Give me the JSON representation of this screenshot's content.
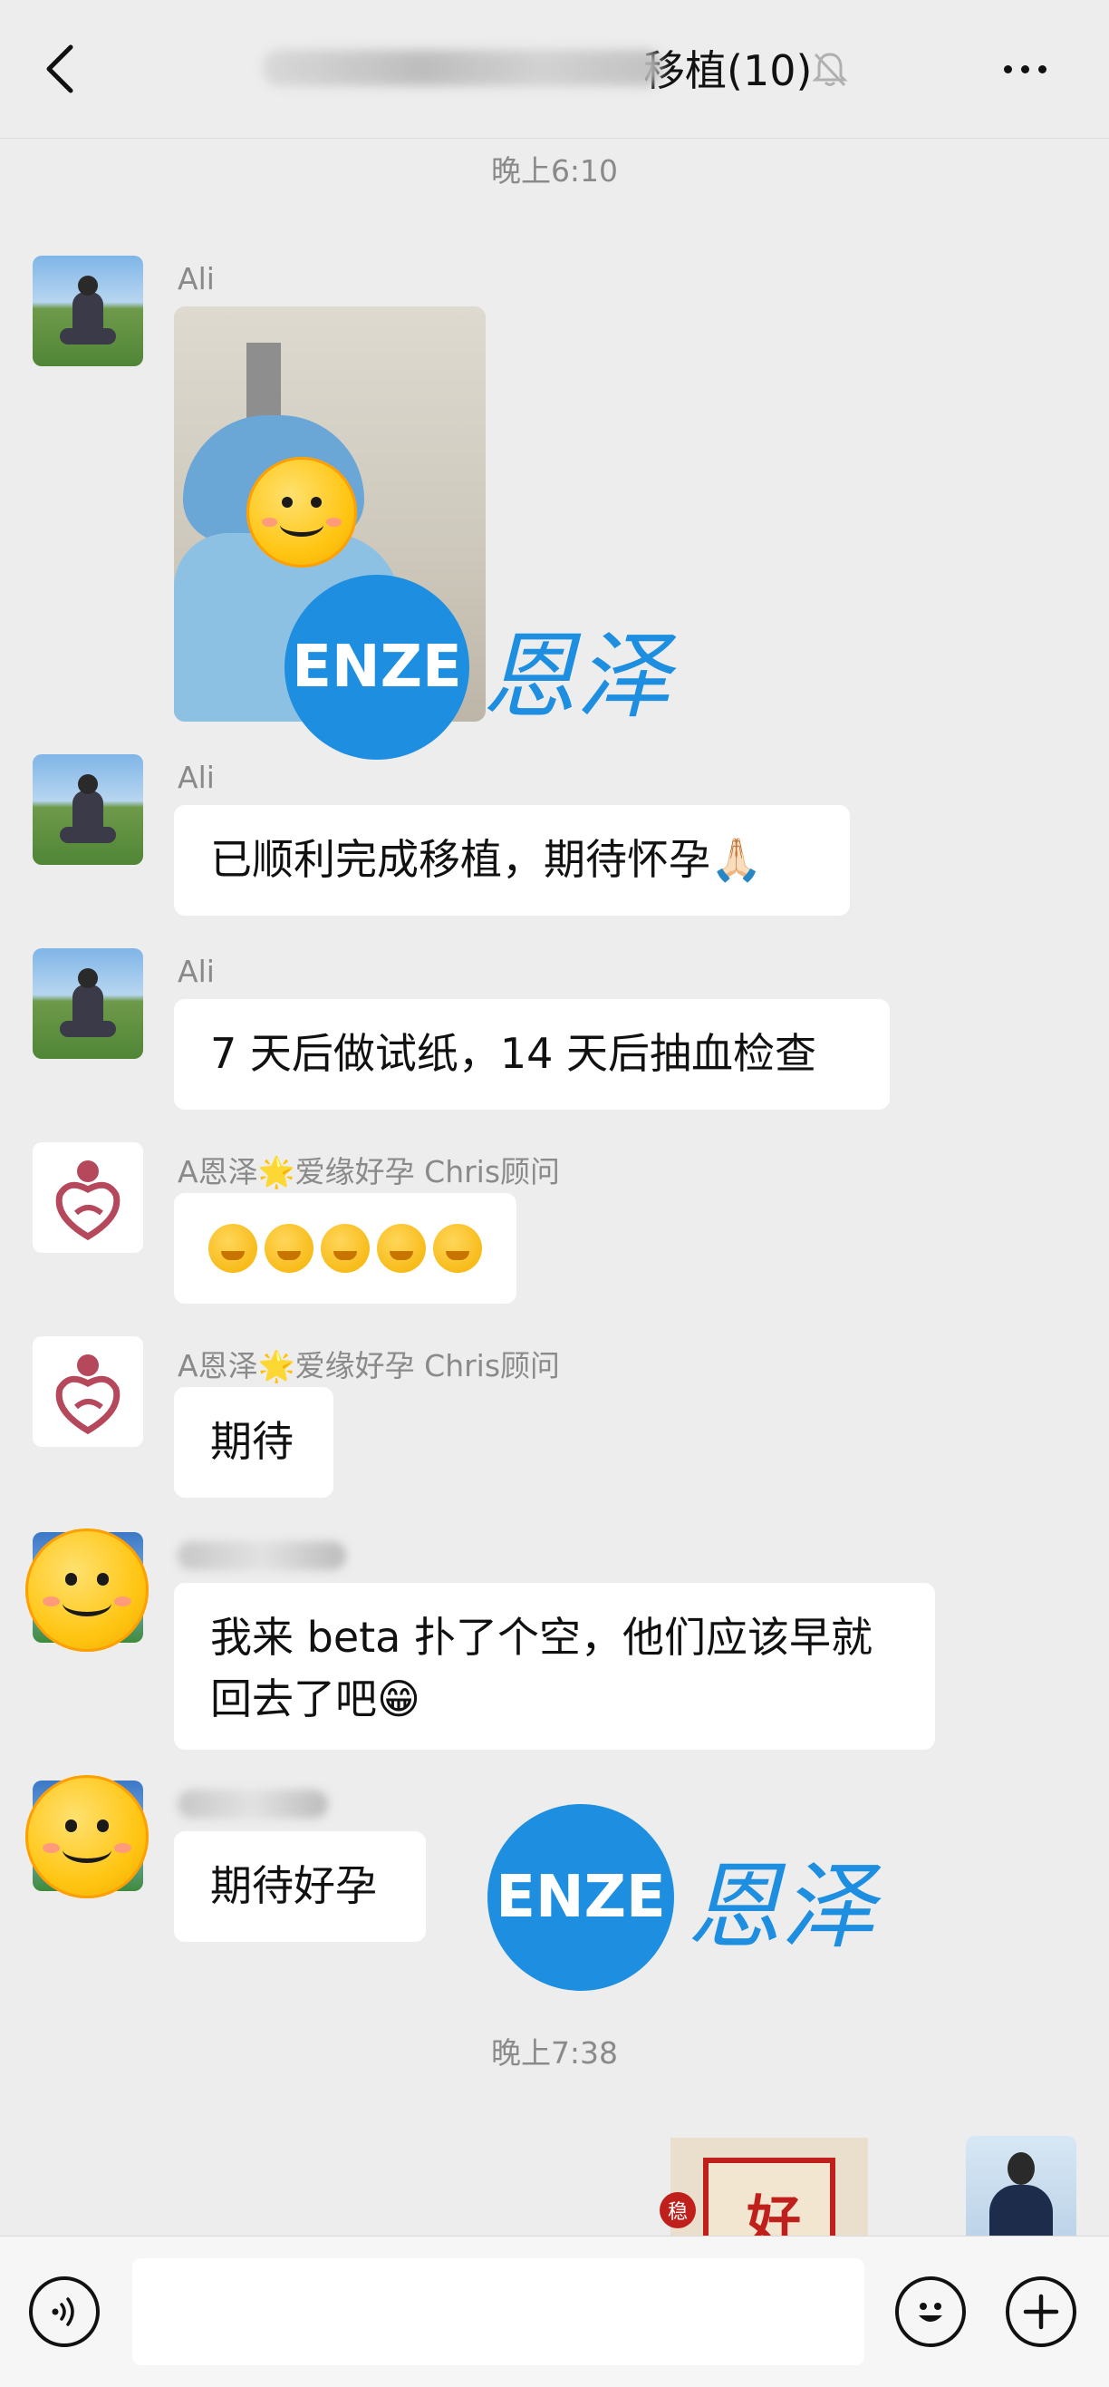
{
  "header": {
    "title_visible": "移植(10)",
    "back_icon": "chevron-left-icon",
    "mute_icon": "bell-slash-icon",
    "more_icon": "more-horizontal-icon"
  },
  "timestamps": [
    "晚上6:10",
    "晚上7:38"
  ],
  "messages": [
    {
      "sender": "Ali",
      "type": "image"
    },
    {
      "sender": "Ali",
      "text": "已顺利完成移植，期待怀孕🙏🏻"
    },
    {
      "sender": "Ali",
      "text": "7 天后做试纸，14 天后抽血检查"
    },
    {
      "sender": "A恩泽🌟爱缘好孕 Chris顾问",
      "type": "emoji",
      "emoji_count": 5
    },
    {
      "sender": "A恩泽🌟爱缘好孕 Chris顾问",
      "text": "期待"
    },
    {
      "sender": "",
      "text": "我来 beta 扑了个空，他们应该早就回去了吧😁"
    },
    {
      "sender": "",
      "text": "期待好孕"
    }
  ],
  "watermark": {
    "latin": "ENZE",
    "chinese": "恩泽"
  },
  "sent_card": {
    "char": "好",
    "seal": "稳"
  },
  "input_bar": {
    "placeholder": "",
    "voice_icon": "voice-icon",
    "emoji_icon": "emoji-smile-icon",
    "plus_icon": "plus-icon"
  },
  "colors": {
    "background": "#ededed",
    "bubble": "#ffffff",
    "watermark_blue": "#1e8fe0"
  }
}
